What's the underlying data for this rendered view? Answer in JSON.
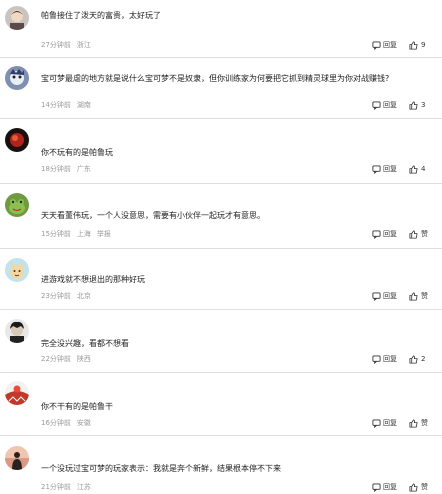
{
  "comments": [
    {
      "text": "帕鲁接住了泼天的富贵，太好玩了",
      "time": "27分钟前",
      "location": "浙江",
      "reply_label": "回复",
      "likes": "9",
      "avatar_icon": "cartoon-character-avatar"
    },
    {
      "text": "宝可梦最虐的地方就是说什么宝可梦不是奴隶，但你训练家为何要把它抓到精灵球里为你对战赚钱?",
      "time": "14分钟前",
      "location": "湖南",
      "reply_label": "回复",
      "likes": "3",
      "avatar_icon": "anime-character-avatar"
    },
    {
      "text": "你不玩有的是帕鲁玩",
      "time": "18分钟前",
      "location": "广东",
      "reply_label": "回复",
      "likes": "4",
      "avatar_icon": "red-orb-avatar"
    },
    {
      "text": "天天看董伟玩，一个人没意思，需要有小伙伴一起玩才有意思。",
      "time": "15分钟前",
      "location": "上海",
      "extra": "举报",
      "reply_label": "回复",
      "likes": "赞",
      "avatar_icon": "frog-avatar"
    },
    {
      "text": "进游戏就不想退出的那种好玩",
      "time": "23分钟前",
      "location": "北京",
      "reply_label": "回复",
      "likes": "赞",
      "avatar_icon": "cartoon-cat-avatar"
    },
    {
      "text": "完全没兴趣，看都不想看",
      "time": "22分钟前",
      "location": "陕西",
      "reply_label": "回复",
      "likes": "2",
      "avatar_icon": "dark-character-avatar"
    },
    {
      "text": "你不干有的是帕鲁干",
      "time": "16分钟前",
      "location": "安徽",
      "reply_label": "回复",
      "likes": "赞",
      "avatar_icon": "red-white-avatar"
    },
    {
      "text": "一个没玩过宝可梦的玩家表示：我就是奔个新鲜，结果根本停不下来",
      "time": "21分钟前",
      "location": "江苏",
      "reply_label": "回复",
      "likes": "赞",
      "avatar_icon": "sunset-silhouette-avatar"
    }
  ],
  "colors": {
    "text": "#222222",
    "meta": "#999999",
    "divider": "#dddddd"
  }
}
